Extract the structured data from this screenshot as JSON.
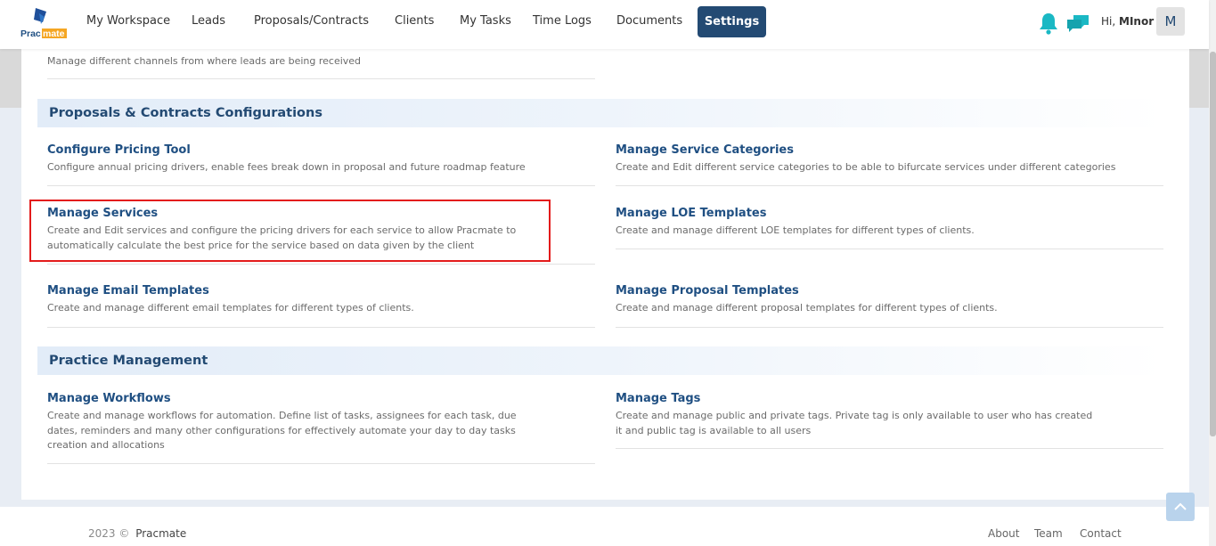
{
  "nav": {
    "logo_text": "Pracmate",
    "items": [
      "My Workspace",
      "Leads",
      "Proposals/Contracts",
      "Clients",
      "My Tasks",
      "Time Logs",
      "Documents"
    ],
    "active": "Settings",
    "greeting_prefix": "Hi,",
    "user_name": "MInor",
    "avatar_letter": "M",
    "accent": "#234a73",
    "icon_color": "#1ab8c4"
  },
  "top_partial": {
    "desc": "Manage different channels from where leads are being received"
  },
  "sections": [
    {
      "title": "Proposals & Contracts Configurations",
      "items": [
        {
          "title": "Configure Pricing Tool",
          "desc": "Configure annual pricing drivers, enable fees break down in proposal and future roadmap feature"
        },
        {
          "title": "Manage Service Categories",
          "desc": "Create and Edit different service categories to be able to bifurcate services under different categories"
        },
        {
          "title": "Manage Services",
          "desc": "Create and Edit services and configure the pricing drivers for each service to allow Pracmate to automatically calculate the best price for the service based on data given by the client"
        },
        {
          "title": "Manage LOE Templates",
          "desc": "Create and manage different LOE templates for different types of clients."
        },
        {
          "title": "Manage Email Templates",
          "desc": "Create and manage different email templates for different types of clients."
        },
        {
          "title": "Manage Proposal Templates",
          "desc": "Create and manage different proposal templates for different types of clients."
        }
      ]
    },
    {
      "title": "Practice Management",
      "items": [
        {
          "title": "Manage Workflows",
          "desc": "Create and manage workflows for automation. Define list of tasks, assignees for each task, due dates, reminders and many other configurations for effectively automate your day to day tasks creation and allocations"
        },
        {
          "title": "Manage Tags",
          "desc": "Create and manage public and private tags. Private tag is only available to user who has created it and public tag is available to all users"
        }
      ]
    }
  ],
  "footer": {
    "year": "2023 ©",
    "brand": "Pracmate",
    "links": [
      "About",
      "Team",
      "Contact"
    ]
  },
  "highlight_color": "#e31b1b"
}
